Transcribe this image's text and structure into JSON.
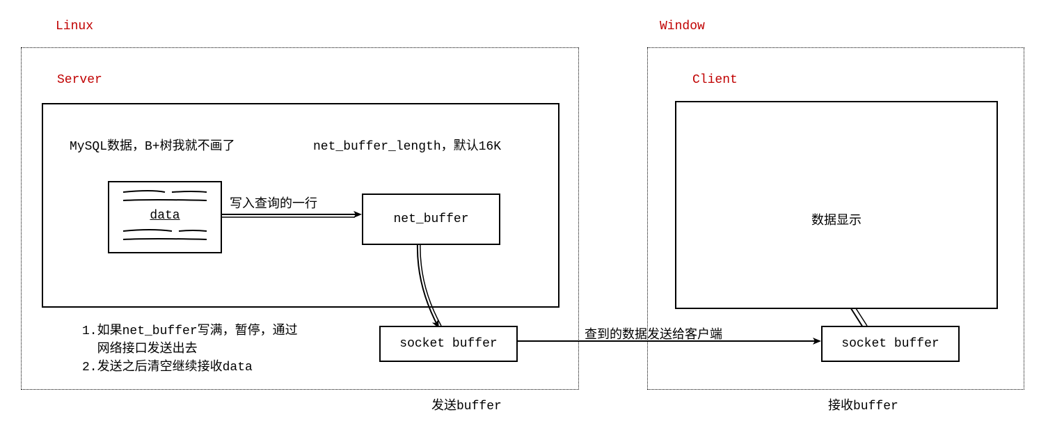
{
  "linux": {
    "label": "Linux",
    "server_label": "Server",
    "mysql_note": "MySQL数据，B+树我就不画了",
    "net_buffer_note": "net_buffer_length，默认16K",
    "data_box": "data",
    "arrow_write_row": "写入查询的一行",
    "net_buffer_box": "net_buffer",
    "socket_buffer_box": "socket buffer",
    "notes_line1": "1.如果net_buffer写满，暂停，通过",
    "notes_line1b": "  网络接口发送出去",
    "notes_line2": "2.发送之后清空继续接收data",
    "send_buffer_label": "发送buffer"
  },
  "window": {
    "label": "Window",
    "client_label": "Client",
    "display_text": "数据显示",
    "socket_buffer_box": "socket buffer",
    "recv_buffer_label": "接收buffer"
  },
  "cross_arrow_label": "查到的数据发送给客户端"
}
